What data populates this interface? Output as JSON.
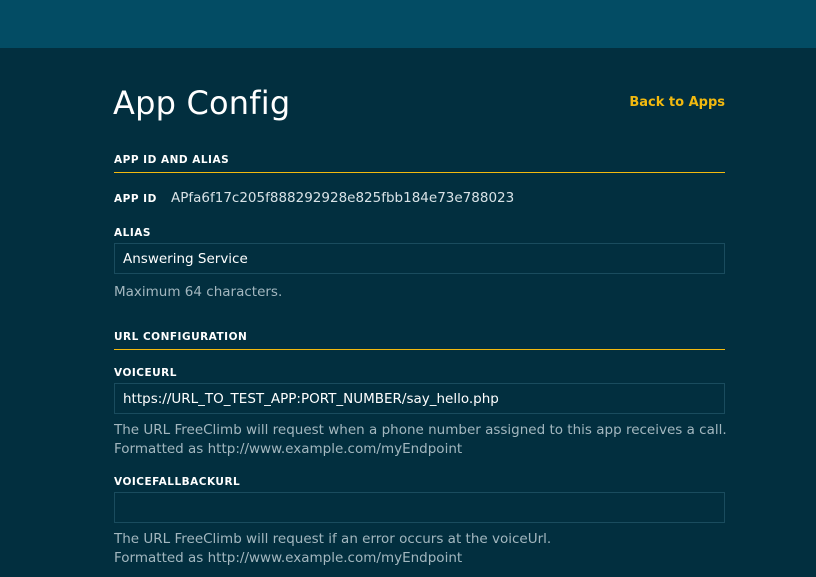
{
  "header": {
    "title": "App Config",
    "back_link": "Back to Apps"
  },
  "app_id_section": {
    "title": "APP ID AND ALIAS",
    "app_id_label": "APP ID",
    "app_id_value": "APfa6f17c205f888292928e825fbb184e73e788023",
    "alias_label": "ALIAS",
    "alias_value": "Answering Service",
    "alias_help": "Maximum 64 characters."
  },
  "url_section": {
    "title": "URL CONFIGURATION",
    "voice_url_label": "VOICEURL",
    "voice_url_value": "https://URL_TO_TEST_APP:PORT_NUMBER/say_hello.php",
    "voice_url_help_line1": "The URL FreeClimb will request when a phone number assigned to this app receives a call.",
    "voice_url_help_line2": "Formatted as http://www.example.com/myEndpoint",
    "voice_fallback_label": "VOICEFALLBACKURL",
    "voice_fallback_value": "",
    "voice_fallback_help_line1": "The URL FreeClimb will request if an error occurs at the voiceUrl.",
    "voice_fallback_help_line2": "Formatted as http://www.example.com/myEndpoint"
  },
  "colors": {
    "background": "#022f3f",
    "topbar": "#034c64",
    "accent": "#f2b90f"
  }
}
